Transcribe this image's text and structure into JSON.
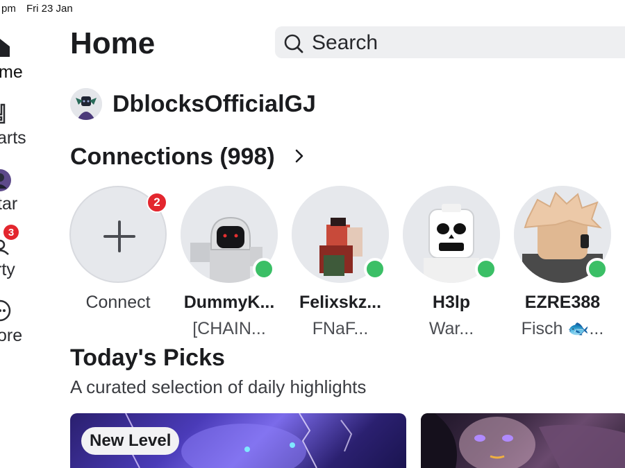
{
  "status_bar": {
    "time": "pm",
    "date": "Fri 23 Jan"
  },
  "sidebar": {
    "items": [
      {
        "label": "me",
        "icon": "home-icon",
        "active": true
      },
      {
        "label": "arts",
        "icon": "charts-icon"
      },
      {
        "label": "tar",
        "icon": "avatar-icon"
      },
      {
        "label": "rty",
        "icon": "party-icon",
        "badge": "3"
      },
      {
        "label": "ore",
        "icon": "more-icon"
      }
    ]
  },
  "header": {
    "title": "Home",
    "search_placeholder": "Search",
    "search_icon": "search-icon"
  },
  "profile": {
    "username": "DblocksOfficialGJ"
  },
  "connections": {
    "title": "Connections (998)",
    "connect_label": "Connect",
    "connect_badge": "2",
    "online_color": "#3bbf66",
    "friends": [
      {
        "name": "DummyK...",
        "status": "[CHAIN..."
      },
      {
        "name": "Felixskz...",
        "status": "FNaF..."
      },
      {
        "name": "H3lp",
        "status": "War..."
      },
      {
        "name": "EZRE388",
        "status": "Fisch 🐟..."
      }
    ]
  },
  "todays_picks": {
    "title": "Today's Picks",
    "subtitle": "A curated selection of daily highlights",
    "cards": [
      {
        "tag": "New Level"
      }
    ]
  },
  "colors": {
    "accent_badge": "#e3262e",
    "search_bg": "#eeeff1"
  }
}
